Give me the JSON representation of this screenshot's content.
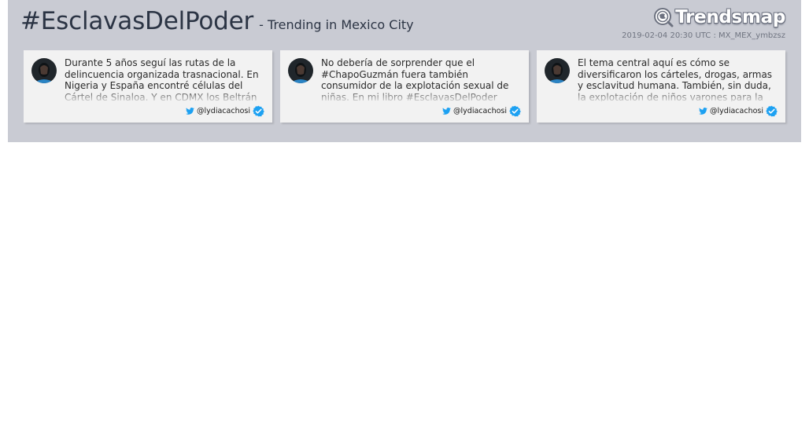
{
  "header": {
    "hashtag": "#EsclavasDelPoder",
    "subtitle": "- Trending in Mexico City",
    "logo_text": "Trendsmap",
    "logo_icon": "globe-magnifier-icon",
    "meta": "2019-02-04 20:30 UTC : MX_MEX_ymbzsz"
  },
  "colors": {
    "banner_bg": "#c9cbd3",
    "card_bg": "#f2f2f2",
    "title_text": "#2b3444",
    "twitter_blue": "#1da1f2",
    "verified_blue": "#1da1f2"
  },
  "tweets": [
    {
      "text": "Durante 5 años seguí las rutas de la delincuencia organizada trasnacional. En Nigeria y España encontré células del Cártel de Sinaloa. Y en CDMX los Beltrán",
      "handle": "@lydiacachosi",
      "verified": true,
      "avatar_icon": "user-avatar",
      "network_icon": "twitter-bird-icon",
      "badge_icon": "verified-check-icon"
    },
    {
      "text": "No debería de sorprender que el #ChapoGuzmán fuera también consumidor de la explotación sexual de niñas. En mi libro #EsclavasDelPoder",
      "handle": "@lydiacachosi",
      "verified": true,
      "avatar_icon": "user-avatar",
      "network_icon": "twitter-bird-icon",
      "badge_icon": "verified-check-icon"
    },
    {
      "text": "El tema central aquí es cómo se diversificaron los cárteles, drogas, armas y esclavitud humana. También, sin duda, la explotación de niños varones para la",
      "handle": "@lydiacachosi",
      "verified": true,
      "avatar_icon": "user-avatar",
      "network_icon": "twitter-bird-icon",
      "badge_icon": "verified-check-icon"
    }
  ]
}
